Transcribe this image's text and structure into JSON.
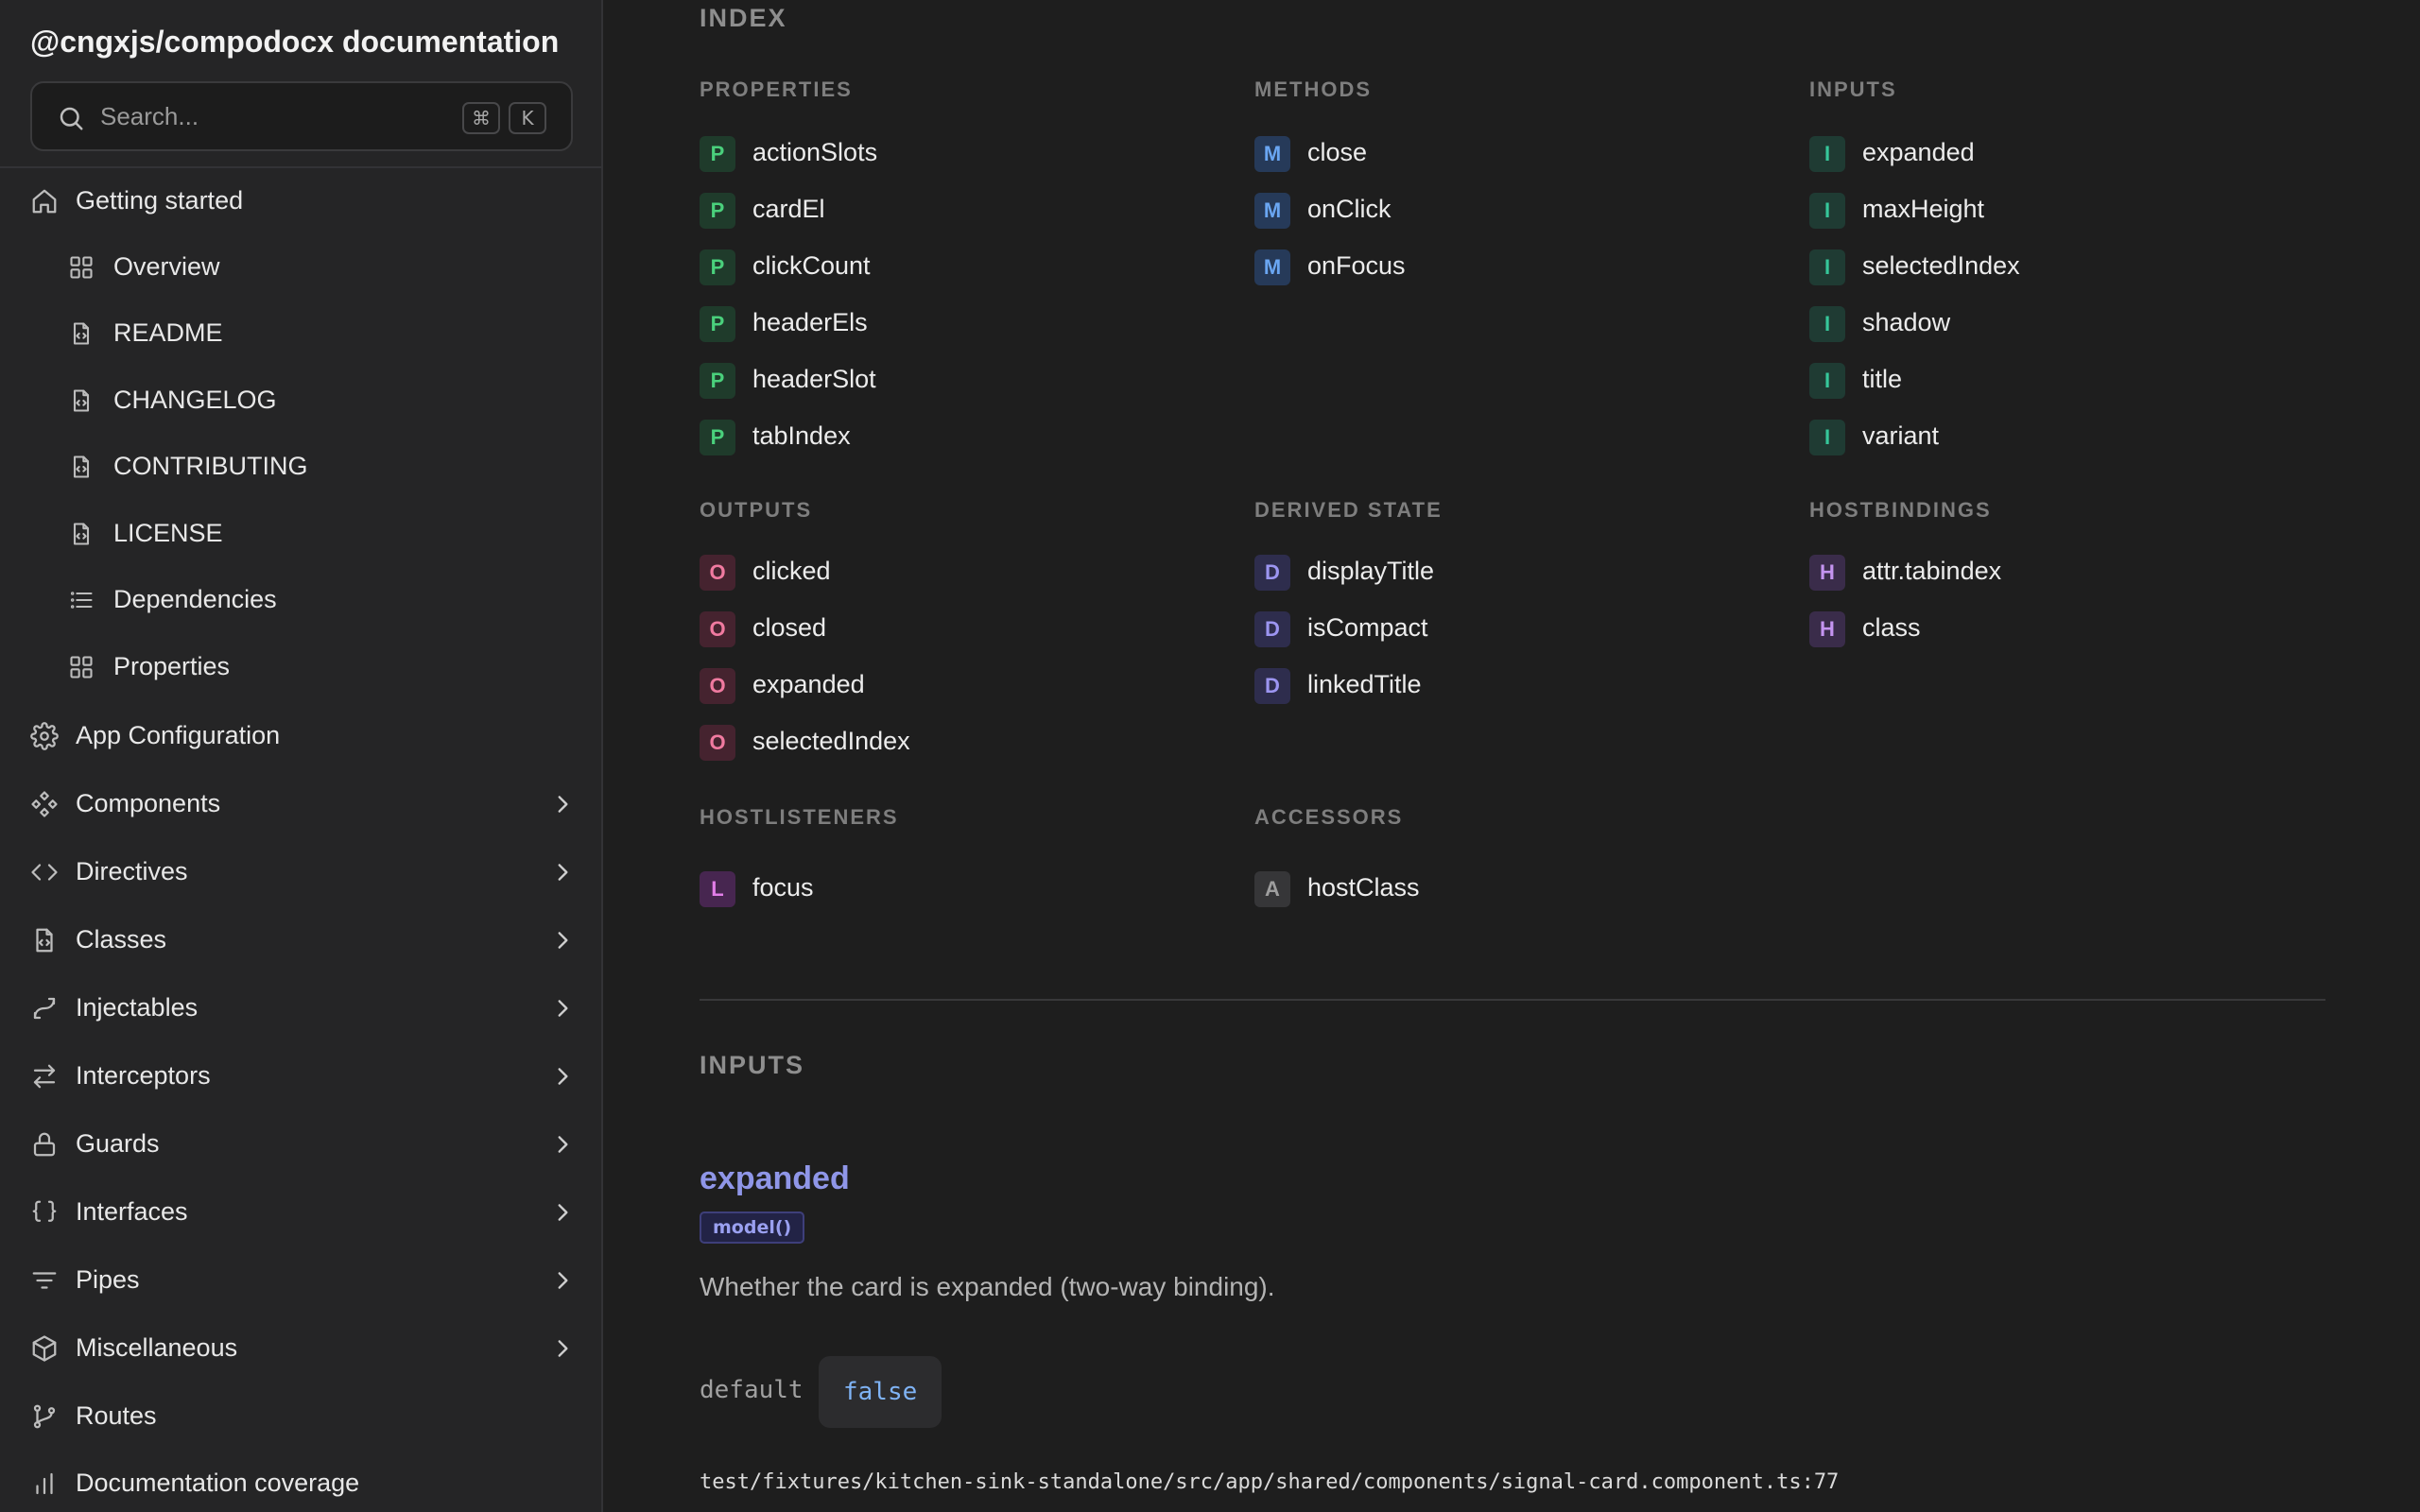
{
  "sidebar": {
    "brand": "@cngxjs/compodocx documentation",
    "search": {
      "placeholder": "Search...",
      "kbd_mod": "⌘",
      "kbd_key": "K"
    },
    "items": [
      {
        "label": "Getting started",
        "icon": "home-icon",
        "level": "top"
      },
      {
        "label": "Overview",
        "icon": "grid-icon",
        "level": "sub"
      },
      {
        "label": "README",
        "icon": "file-code-icon",
        "level": "sub"
      },
      {
        "label": "CHANGELOG",
        "icon": "file-code-icon",
        "level": "sub"
      },
      {
        "label": "CONTRIBUTING",
        "icon": "file-code-icon",
        "level": "sub"
      },
      {
        "label": "LICENSE",
        "icon": "file-code-icon",
        "level": "sub"
      },
      {
        "label": "Dependencies",
        "icon": "list-icon",
        "level": "sub"
      },
      {
        "label": "Properties",
        "icon": "grid-icon",
        "level": "sub"
      },
      {
        "label": "App Configuration",
        "icon": "gear-icon",
        "level": "top"
      },
      {
        "label": "Components",
        "icon": "components-icon",
        "level": "top",
        "expandable": true
      },
      {
        "label": "Directives",
        "icon": "code-brackets-icon",
        "level": "top",
        "expandable": true
      },
      {
        "label": "Classes",
        "icon": "file-code-icon",
        "level": "top",
        "expandable": true
      },
      {
        "label": "Injectables",
        "icon": "injectable-icon",
        "level": "top",
        "expandable": true
      },
      {
        "label": "Interceptors",
        "icon": "arrows-swap-icon",
        "level": "top",
        "expandable": true
      },
      {
        "label": "Guards",
        "icon": "lock-icon",
        "level": "top",
        "expandable": true
      },
      {
        "label": "Interfaces",
        "icon": "curly-braces-icon",
        "level": "top",
        "expandable": true
      },
      {
        "label": "Pipes",
        "icon": "filter-icon",
        "level": "top",
        "expandable": true
      },
      {
        "label": "Miscellaneous",
        "icon": "cube-icon",
        "level": "top",
        "expandable": true
      },
      {
        "label": "Routes",
        "icon": "git-branch-icon",
        "level": "top"
      },
      {
        "label": "Documentation coverage",
        "icon": "bar-chart-icon",
        "level": "top"
      }
    ]
  },
  "index": {
    "title": "INDEX",
    "groups": [
      {
        "title": "PROPERTIES",
        "badge": "P",
        "entries": [
          "actionSlots",
          "cardEl",
          "clickCount",
          "headerEls",
          "headerSlot",
          "tabIndex"
        ]
      },
      {
        "title": "METHODS",
        "badge": "M",
        "entries": [
          "close",
          "onClick",
          "onFocus"
        ]
      },
      {
        "title": "INPUTS",
        "badge": "I",
        "entries": [
          "expanded",
          "maxHeight",
          "selectedIndex",
          "shadow",
          "title",
          "variant"
        ]
      },
      {
        "title": "OUTPUTS",
        "badge": "O",
        "entries": [
          "clicked",
          "closed",
          "expanded",
          "selectedIndex"
        ]
      },
      {
        "title": "DERIVED STATE",
        "badge": "D",
        "entries": [
          "displayTitle",
          "isCompact",
          "linkedTitle"
        ]
      },
      {
        "title": "HOSTBINDINGS",
        "badge": "H",
        "entries": [
          "attr.tabindex",
          "class"
        ]
      },
      {
        "title": "HOSTLISTENERS",
        "badge": "L",
        "entries": [
          "focus"
        ]
      },
      {
        "title": "ACCESSORS",
        "badge": "A",
        "entries": [
          "hostClass"
        ]
      }
    ]
  },
  "inputs_section": {
    "title": "INPUTS",
    "property": {
      "name": "expanded",
      "tag": "model()",
      "description": "Whether the card is expanded (two-way binding).",
      "default_label": "default",
      "default_value": "false",
      "source": "test/fixtures/kitchen-sink-standalone/src/app/shared/components/signal-card.component.ts:77"
    }
  }
}
